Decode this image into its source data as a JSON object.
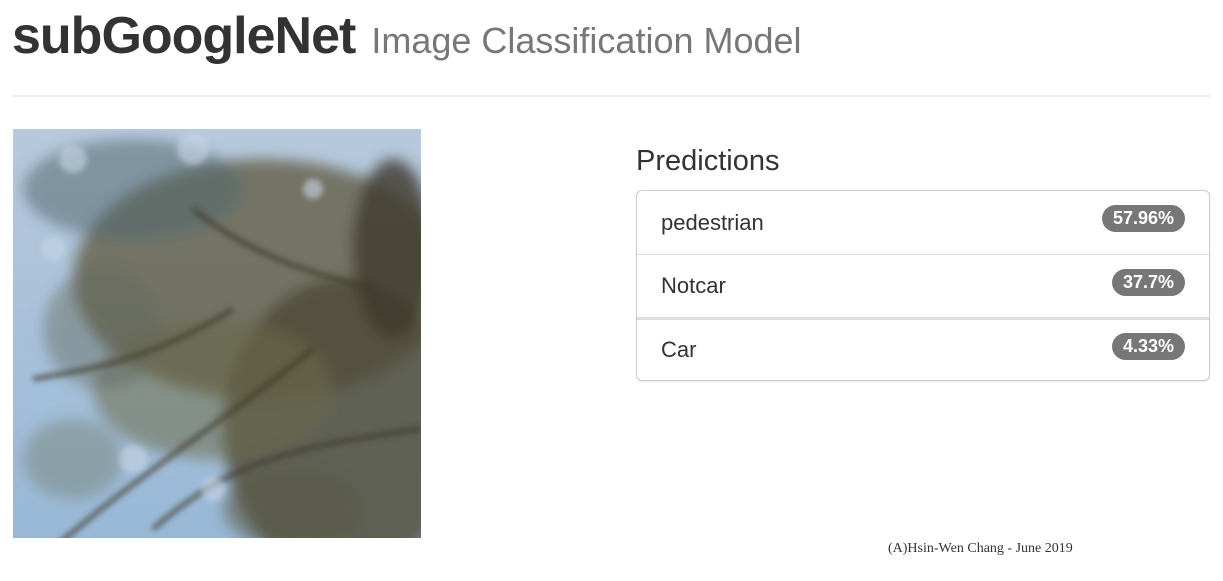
{
  "header": {
    "title": "subGoogleNet",
    "subtitle": "Image Classification Model"
  },
  "image": {
    "icon": "tree-branches-sky-photo"
  },
  "predictions": {
    "heading": "Predictions",
    "items": [
      {
        "label": "pedestrian",
        "value": "57.96%"
      },
      {
        "label": "Notcar",
        "value": "37.7%"
      },
      {
        "label": "Car",
        "value": "4.33%"
      }
    ]
  },
  "footer": {
    "credit": "(A)Hsin-Wen Chang - June 2019"
  },
  "colors": {
    "text": "#333333",
    "subtitle": "#777777",
    "badge": "#777777",
    "divider": "#eeeeee",
    "sky": "#a9c3dc",
    "foliage": "#5c5a3c"
  }
}
